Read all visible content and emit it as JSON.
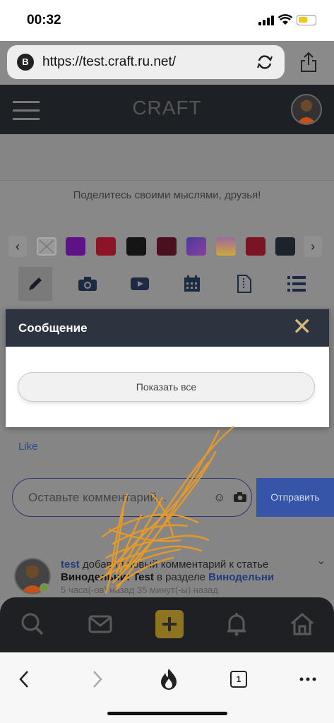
{
  "status_bar": {
    "time": "00:32"
  },
  "browser": {
    "badge": "B",
    "url": "https://test.craft.ru.net/",
    "tab_count": "1"
  },
  "site": {
    "logo": "CRAFT"
  },
  "composer": {
    "placeholder": "Поделитесь своими мыслями, друзья!",
    "swatches": [
      "#e8e8e8",
      "#7a10c0",
      "#c0182e",
      "#151515",
      "#5a1020",
      "#8a3fc0",
      "#e8c040",
      "#a01028",
      "#1d232b"
    ],
    "tools": [
      "pencil-icon",
      "camera-icon",
      "video-icon",
      "calendar-icon",
      "file-icon",
      "list-icon"
    ]
  },
  "modal": {
    "title": "Сообщение",
    "close": "✕",
    "show_all": "Показать все"
  },
  "post": {
    "like": "Like",
    "comment_placeholder": "Оставьте комментарий...",
    "send": "Отправить"
  },
  "feed": {
    "user": "test",
    "action": "добавил новый комментарий к статье",
    "article": "Винодельни: Test",
    "in_section": "в разделе",
    "section": "Винодельни",
    "time": "5 часа(-ов) назад 35 минут(-ы) назад"
  },
  "colors": {
    "header": "#1d2126",
    "modal_header": "#2c3440",
    "accent": "#3556a8",
    "scribble": "#e39a2b"
  }
}
